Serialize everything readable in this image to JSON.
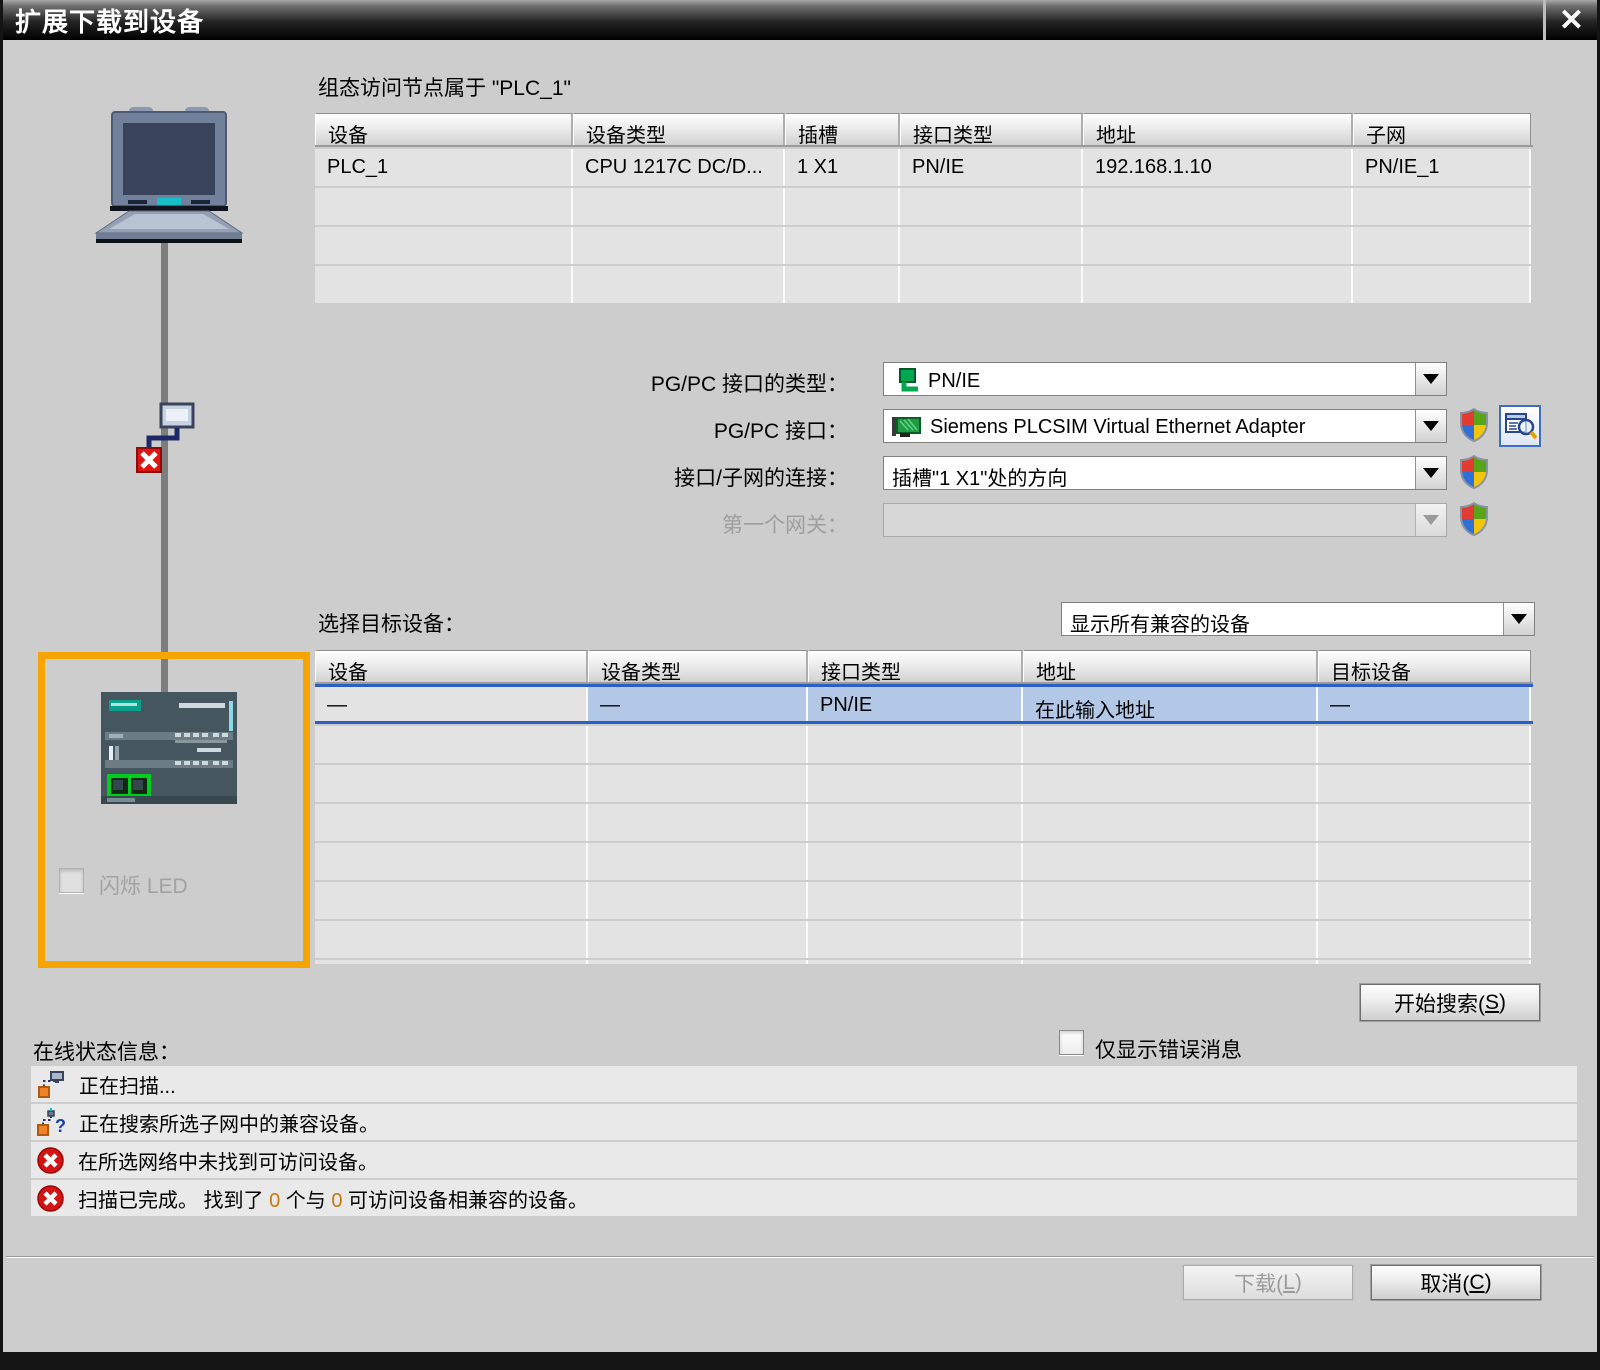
{
  "dialog": {
    "title": "扩展下载到设备",
    "close_glyph": "✕"
  },
  "config_table": {
    "caption": "组态访问节点属于 \"PLC_1\"",
    "headers": [
      "设备",
      "设备类型",
      "插槽",
      "接口类型",
      "地址",
      "子网"
    ],
    "rows": [
      [
        "PLC_1",
        "CPU 1217C DC/D...",
        "1 X1",
        "PN/IE",
        "192.168.1.10",
        "PN/IE_1"
      ]
    ]
  },
  "pgpc": {
    "type_label": "PG/PC 接口的类型：",
    "type_value": "PN/IE",
    "interface_label": "PG/PC 接口：",
    "interface_value": "Siemens PLCSIM Virtual Ethernet Adapter",
    "connection_label": "接口/子网的连接：",
    "connection_value": "插槽\"1 X1\"处的方向",
    "gateway_label": "第一个网关：",
    "gateway_value": ""
  },
  "target": {
    "select_label": "选择目标设备：",
    "filter_value": "显示所有兼容的设备",
    "headers": [
      "设备",
      "设备类型",
      "接口类型",
      "地址",
      "目标设备"
    ],
    "selected_row": [
      "—",
      "—",
      "PN/IE",
      "在此输入地址",
      "—"
    ],
    "flash_led_label": "闪烁 LED",
    "start_search_parts": [
      "开始搜索(",
      "S",
      ")"
    ]
  },
  "status": {
    "label": "在线状态信息：",
    "errors_only_label": "仅显示错误消息",
    "messages": [
      {
        "icon": "scan-icon",
        "parts": [
          "正在扫描...",
          "",
          "",
          "",
          ""
        ]
      },
      {
        "icon": "search-icon",
        "parts": [
          "正在搜索所选子网中的兼容设备。",
          "",
          "",
          "",
          ""
        ]
      },
      {
        "icon": "error-icon",
        "parts": [
          "在所选网络中未找到可访问设备。",
          "",
          "",
          "",
          ""
        ]
      },
      {
        "icon": "error-icon",
        "parts": [
          "扫描已完成。 找到了 ",
          "0",
          " 个与 ",
          "0",
          " 可访问设备相兼容的设备。"
        ]
      }
    ]
  },
  "footer": {
    "download_parts": [
      "下载(",
      "L",
      ")"
    ],
    "cancel_parts": [
      "取消(",
      "C",
      ")"
    ]
  },
  "colors": {
    "accent_orange": "#F6A500",
    "selection_blue": "#B3C7E6",
    "selection_border": "#2E5FC0",
    "error_red": "#D21414",
    "titlebar": "#000000"
  }
}
